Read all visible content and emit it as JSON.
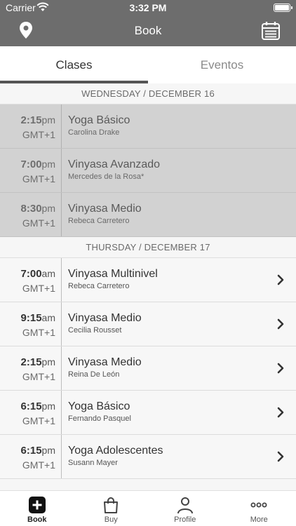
{
  "status_bar": {
    "carrier": "Carrier",
    "time": "3:32 PM"
  },
  "header": {
    "title": "Book",
    "left_icon": "location-pin-icon",
    "right_icon": "calendar-icon"
  },
  "tabs": [
    {
      "label": "Clases",
      "active": true
    },
    {
      "label": "Eventos",
      "active": false
    }
  ],
  "days": [
    {
      "header": "WEDNESDAY / DECEMBER 16",
      "classes": [
        {
          "time": "2:15",
          "ampm": "pm",
          "tz": "GMT+1",
          "name": "Yoga Básico",
          "teacher": "Carolina Drake",
          "past": true
        },
        {
          "time": "7:00",
          "ampm": "pm",
          "tz": "GMT+1",
          "name": "Vinyasa Avanzado",
          "teacher": "Mercedes de la Rosa*",
          "past": true
        },
        {
          "time": "8:30",
          "ampm": "pm",
          "tz": "GMT+1",
          "name": "Vinyasa Medio",
          "teacher": "Rebeca Carretero",
          "past": true
        }
      ]
    },
    {
      "header": "THURSDAY / DECEMBER 17",
      "classes": [
        {
          "time": "7:00",
          "ampm": "am",
          "tz": "GMT+1",
          "name": "Vinyasa Multinivel",
          "teacher": "Rebeca Carretero",
          "past": false
        },
        {
          "time": "9:15",
          "ampm": "am",
          "tz": "GMT+1",
          "name": "Vinyasa Medio",
          "teacher": "Cecilia Rousset",
          "past": false
        },
        {
          "time": "2:15",
          "ampm": "pm",
          "tz": "GMT+1",
          "name": "Vinyasa Medio",
          "teacher": "Reina De León",
          "past": false
        },
        {
          "time": "6:15",
          "ampm": "pm",
          "tz": "GMT+1",
          "name": "Yoga Básico",
          "teacher": "Fernando Pasquel",
          "past": false
        },
        {
          "time": "6:15",
          "ampm": "pm",
          "tz": "GMT+1",
          "name": "Yoga Adolescentes",
          "teacher": "Susann Mayer",
          "past": false
        }
      ]
    }
  ],
  "tabbar": [
    {
      "label": "Book",
      "icon": "plus-square-icon",
      "active": true
    },
    {
      "label": "Buy",
      "icon": "shopping-bag-icon",
      "active": false
    },
    {
      "label": "Profile",
      "icon": "person-icon",
      "active": false
    },
    {
      "label": "More",
      "icon": "more-dots-icon",
      "active": false
    }
  ],
  "colors": {
    "header_bg": "#6d6d6d",
    "past_row_bg": "#d2d2d2",
    "tab_indicator": "#555555"
  }
}
